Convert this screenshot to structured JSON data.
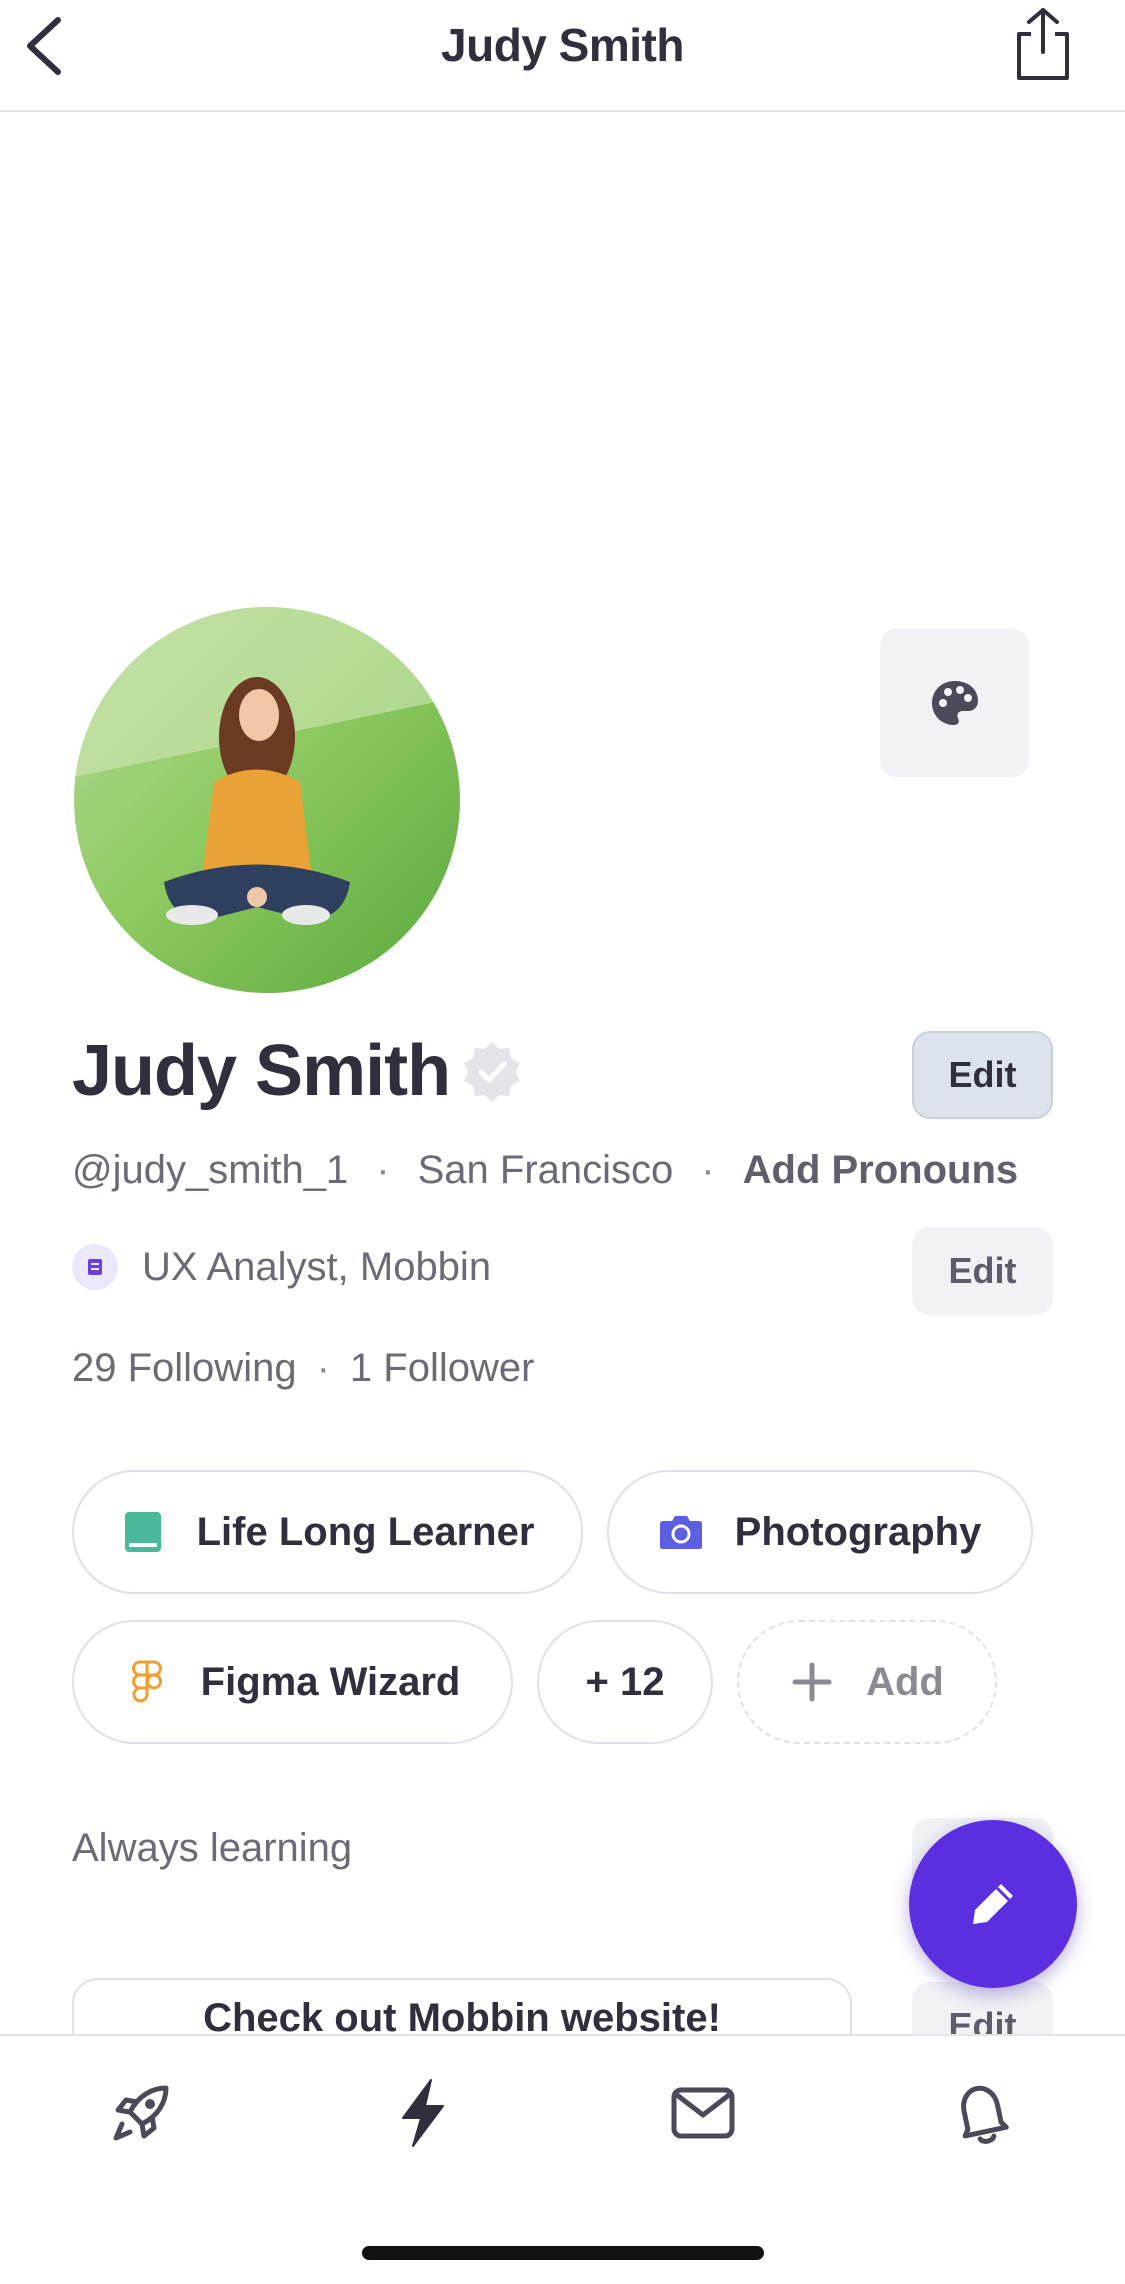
{
  "header": {
    "title": "Judy Smith"
  },
  "profile": {
    "name": "Judy Smith",
    "edit_label": "Edit",
    "handle": "@judy_smith_1",
    "location": "San Francisco",
    "pronouns_label": "Add Pronouns",
    "separator": "·",
    "job": "UX Analyst, Mobbin",
    "job_edit_label": "Edit",
    "following": "29 Following",
    "followers": "1 Follower",
    "bio": "Always learning",
    "link_card_text": "Check out Mobbin website!",
    "link_edit_label": "Edit"
  },
  "chips": [
    {
      "label": "Life Long Learner",
      "icon": "book-icon",
      "color": "#4bb89c"
    },
    {
      "label": "Photography",
      "icon": "camera-icon",
      "color": "#5b5fe0"
    },
    {
      "label": "Figma Wizard",
      "icon": "figma-icon",
      "color": "#f0a030"
    },
    {
      "label": "+ 12"
    },
    {
      "label": "Add",
      "icon": "plus-icon"
    }
  ],
  "tabs": [
    "rocket-icon",
    "bolt-icon",
    "mail-icon",
    "bell-icon"
  ],
  "colors": {
    "accent": "#5b2fe0",
    "chip_border": "#e0e1e6",
    "muted_text": "#6b6b78"
  }
}
